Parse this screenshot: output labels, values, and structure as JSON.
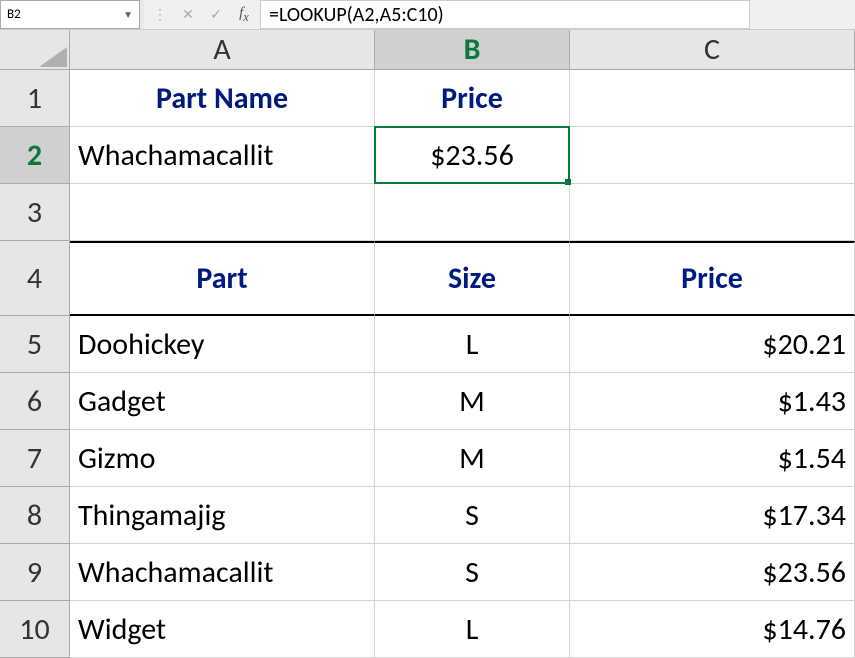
{
  "name_box": "B2",
  "formula": "=LOOKUP(A2,A5:C10)",
  "columns": [
    "A",
    "B",
    "C"
  ],
  "active_column": "B",
  "active_row": "2",
  "rows": [
    "1",
    "2",
    "3",
    "4",
    "5",
    "6",
    "7",
    "8",
    "9",
    "10"
  ],
  "cells": {
    "r1": {
      "a": "Part Name",
      "b": "Price",
      "c": ""
    },
    "r2": {
      "a": "Whachamacallit",
      "b": "$23.56",
      "c": ""
    },
    "r3": {
      "a": "",
      "b": "",
      "c": ""
    },
    "r4": {
      "a": "Part",
      "b": "Size",
      "c": "Price"
    },
    "r5": {
      "a": "Doohickey",
      "b": "L",
      "c": "$20.21"
    },
    "r6": {
      "a": "Gadget",
      "b": "M",
      "c": "$1.43"
    },
    "r7": {
      "a": "Gizmo",
      "b": "M",
      "c": "$1.54"
    },
    "r8": {
      "a": "Thingamajig",
      "b": "S",
      "c": "$17.34"
    },
    "r9": {
      "a": "Whachamacallit",
      "b": "S",
      "c": "$23.56"
    },
    "r10": {
      "a": "Widget",
      "b": "L",
      "c": "$14.76"
    }
  }
}
